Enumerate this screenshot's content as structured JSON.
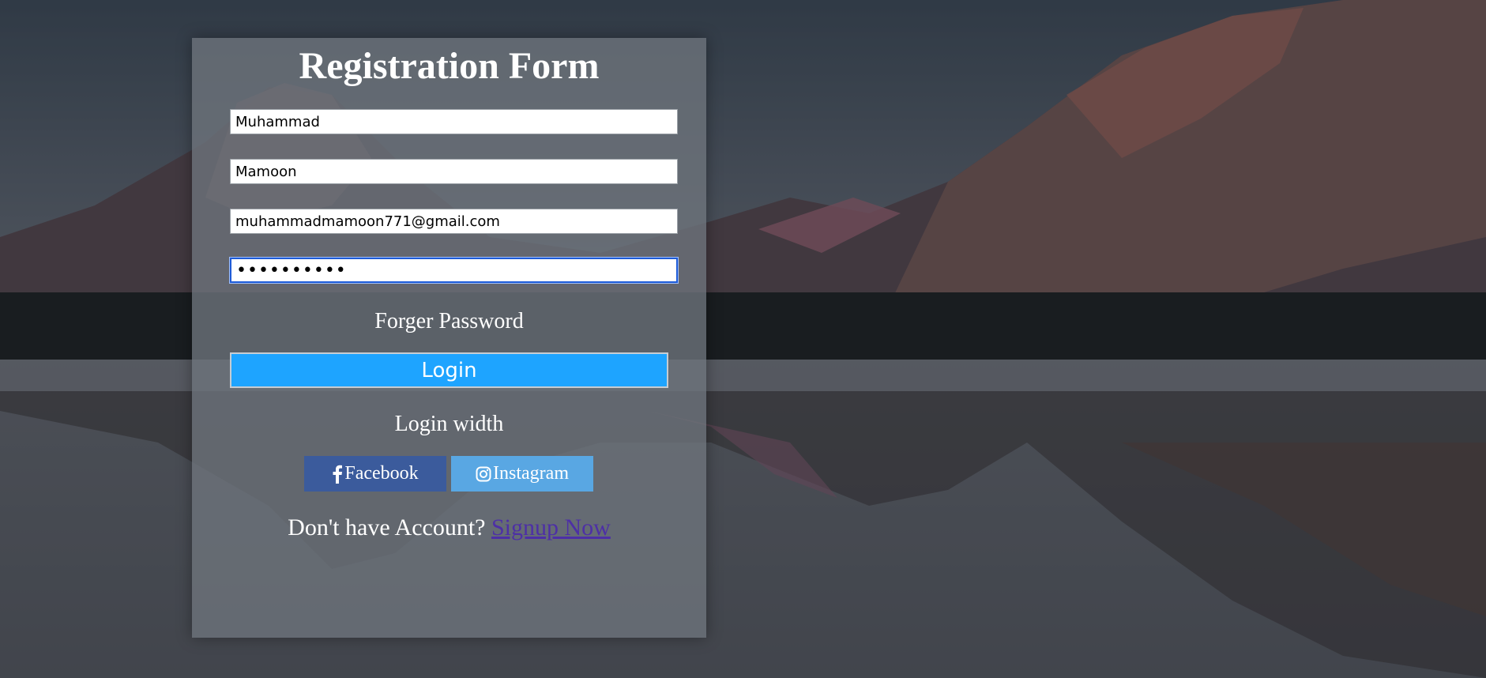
{
  "form": {
    "title": "Registration Form",
    "first_name_value": "Muhammad",
    "last_name_value": "Mamoon",
    "email_value": "muhammadmamoon771@gmail.com",
    "password_value": "••••••••••",
    "forgot_password_label": "Forger Password",
    "login_button_label": "Login",
    "login_with_label": "Login width",
    "facebook_label": "Facebook",
    "instagram_label": "Instagram",
    "no_account_text": "Don't have Account?",
    "signup_link_label": "Signup Now"
  },
  "colors": {
    "login_button": "#1ea4ff",
    "facebook": "#3b5b9c",
    "instagram": "#59a7e3",
    "signup_link": "#4d2fa6"
  },
  "icons": {
    "facebook": "facebook-icon",
    "instagram": "instagram-icon"
  }
}
